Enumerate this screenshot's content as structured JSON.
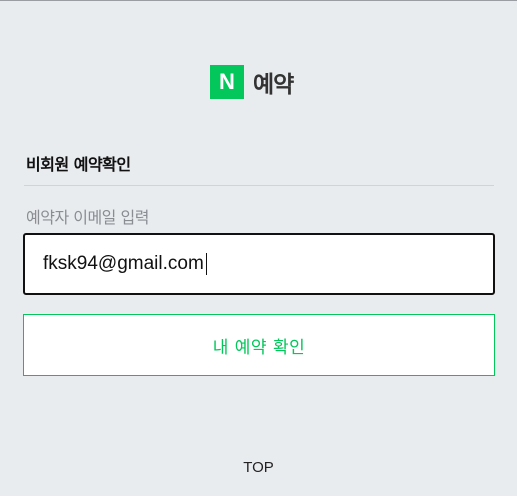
{
  "brand": {
    "logo_letter": "N",
    "title": "예약",
    "color": "#03c75a"
  },
  "form": {
    "section_title": "비회원 예약확인",
    "email_label": "예약자 이메일 입력",
    "email_value": "fksk94@gmail.com",
    "submit_label": "내 예약 확인"
  },
  "footer": {
    "top_label": "TOP"
  },
  "colors": {
    "background": "#e9ecef",
    "accent": "#03c75a",
    "input_border": "#111111"
  }
}
